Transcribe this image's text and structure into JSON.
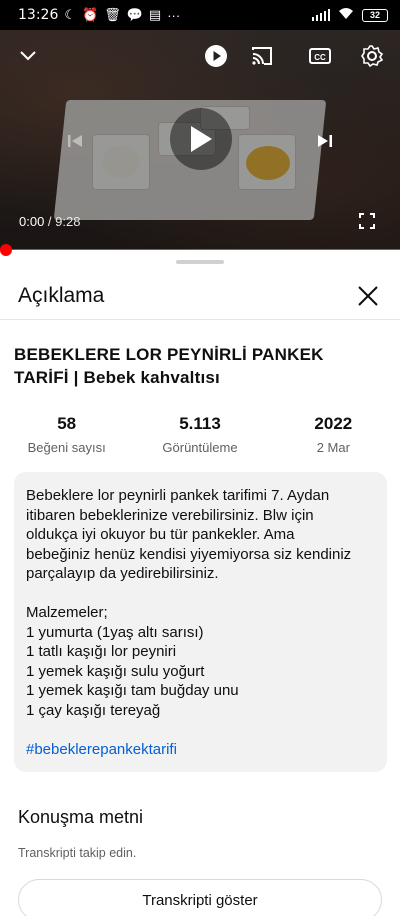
{
  "status_bar": {
    "time": "13:26",
    "battery": "32",
    "left_icons": [
      "moon-icon",
      "alarm-icon",
      "trash-icon",
      "chat-icon",
      "news-icon",
      "more-dots-icon"
    ],
    "right_icons": [
      "signal-icon",
      "wifi-icon",
      "battery-icon"
    ]
  },
  "player": {
    "current_time": "0:00",
    "separator": " / ",
    "duration": "9:28",
    "progress": 0.0,
    "controls": [
      "collapse-chevron-icon",
      "autoplay-toggle-icon",
      "cast-icon",
      "captions-icon",
      "settings-gear-icon",
      "previous-icon",
      "play-icon",
      "next-icon",
      "fullscreen-icon"
    ]
  },
  "sheet": {
    "title": "Açıklama",
    "video_title": "BEBEKLERE LOR PEYNİRLİ PANKEK TARİFİ | Bebek kahvaltısı",
    "stats": [
      {
        "value": "58",
        "label": "Beğeni sayısı"
      },
      {
        "value": "5.113",
        "label": "Görüntüleme"
      },
      {
        "value": "2022",
        "label": "2 Mar"
      }
    ],
    "description": {
      "intro_lines": [
        "Bebeklere lor peynirli pankek tarifimi 7. Aydan",
        "itibaren bebeklerinize verebilirsiniz. Blw için",
        "oldukça iyi okuyor bu tür pankekler. Ama",
        "bebeğiniz henüz kendisi yiyemiyorsa siz kendiniz",
        "parçalayıp da yedirebilirsiniz."
      ],
      "ingredients_heading": "Malzemeler;",
      "ingredients": [
        "1 yumurta (1yaş altı sarısı)",
        "1 tatlı kaşığı lor peyniri",
        "1 yemek kaşığı sulu yoğurt",
        "1 yemek kaşığı tam buğday unu",
        "1 çay kaşığı tereyağ"
      ],
      "hashtag": "#bebeklerepankektarifi"
    },
    "transcript": {
      "title": "Konuşma metni",
      "subtitle": "Transkripti takip edin.",
      "button_label": "Transkripti göster"
    }
  },
  "colors": {
    "accent_red": "#ff0000",
    "link_blue": "#065fd4",
    "description_bg": "#f2f2f2"
  }
}
